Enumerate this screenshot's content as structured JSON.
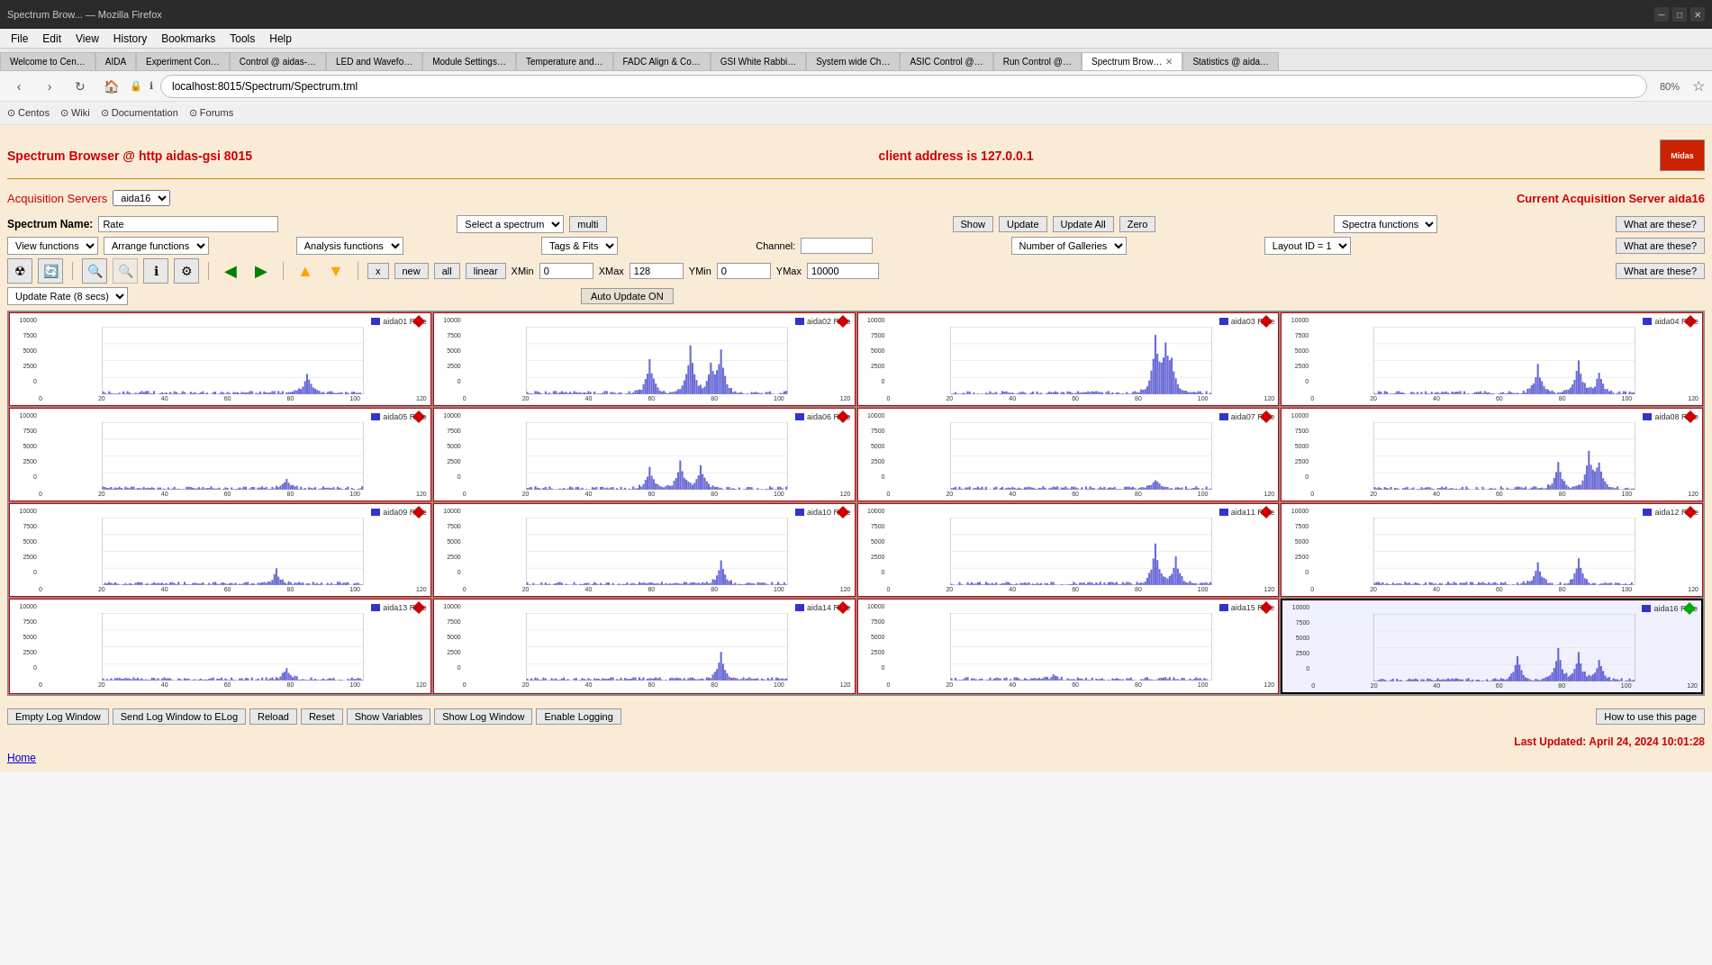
{
  "browser": {
    "title": "Spectrum Brow... — Mozilla Firefox",
    "url": "localhost:8015/Spectrum/Spectrum.tml",
    "zoom": "80%"
  },
  "menu": {
    "items": [
      "File",
      "Edit",
      "View",
      "History",
      "Bookmarks",
      "Tools",
      "Help"
    ]
  },
  "tabs": [
    {
      "label": "Welcome to Cen…",
      "active": false
    },
    {
      "label": "AIDA",
      "active": false
    },
    {
      "label": "Experiment Cont…",
      "active": false
    },
    {
      "label": "Control @ aidas-…",
      "active": false
    },
    {
      "label": "LED and Wavefo…",
      "active": false
    },
    {
      "label": "Module Settings…",
      "active": false
    },
    {
      "label": "Temperature and…",
      "active": false
    },
    {
      "label": "FADC Align & Co…",
      "active": false
    },
    {
      "label": "GSI White Rabbi…",
      "active": false
    },
    {
      "label": "System wide Ch…",
      "active": false
    },
    {
      "label": "ASIC Control @…",
      "active": false
    },
    {
      "label": "Run Control @…",
      "active": false
    },
    {
      "label": "Spectrum Brow…",
      "active": true,
      "closable": true
    },
    {
      "label": "Statistics @ aida…",
      "active": false
    }
  ],
  "bookmarks": [
    {
      "label": "Centos"
    },
    {
      "label": "Wiki"
    },
    {
      "label": "Documentation"
    },
    {
      "label": "Forums"
    }
  ],
  "page": {
    "title": "Spectrum Browser @ http aidas-gsi 8015",
    "client_address": "client address is 127.0.0.1",
    "acq_servers_label": "Acquisition Servers",
    "acq_server_value": "aida16",
    "current_server_label": "Current Acquisition Server aida16"
  },
  "controls": {
    "spectrum_name_label": "Spectrum Name:",
    "spectrum_name_value": "Rate",
    "select_spectrum": "Select a spectrum",
    "multi_btn": "multi",
    "show_btn": "Show",
    "update_btn": "Update",
    "update_all_btn": "Update All",
    "zero_btn": "Zero",
    "spectra_functions": "Spectra functions",
    "what_are_these_1": "What are these?",
    "view_functions": "View functions",
    "arrange_functions": "Arrange functions",
    "analysis_functions": "Analysis functions",
    "tags_fits": "Tags & Fits",
    "channel_label": "Channel:",
    "channel_value": "",
    "number_of_galleries": "Number of Galleries",
    "layout_id": "Layout ID = 1",
    "what_are_these_2": "What are these?",
    "x_btn": "x",
    "new_btn": "new",
    "all_btn": "all",
    "linear_btn": "linear",
    "xmin_label": "XMin",
    "xmin_value": "0",
    "xmax_label": "XMax",
    "xmax_value": "128",
    "ymin_label": "YMin",
    "ymin_value": "0",
    "ymax_label": "YMax",
    "ymax_value": "10000",
    "what_are_these_3": "What are these?",
    "update_rate": "Update Rate (8 secs)",
    "auto_update": "Auto Update ON"
  },
  "charts": [
    {
      "id": "aida01",
      "title": "aida01 Rate",
      "diamond": "red"
    },
    {
      "id": "aida02",
      "title": "aida02 Rate",
      "diamond": "red"
    },
    {
      "id": "aida03",
      "title": "aida03 Rate",
      "diamond": "red"
    },
    {
      "id": "aida04",
      "title": "aida04 Rate",
      "diamond": "red"
    },
    {
      "id": "aida05",
      "title": "aida05 Rate",
      "diamond": "red"
    },
    {
      "id": "aida06",
      "title": "aida06 Rate",
      "diamond": "red"
    },
    {
      "id": "aida07",
      "title": "aida07 Rate",
      "diamond": "red"
    },
    {
      "id": "aida08",
      "title": "aida08 Rate",
      "diamond": "red"
    },
    {
      "id": "aida09",
      "title": "aida09 Rate",
      "diamond": "red"
    },
    {
      "id": "aida10",
      "title": "aida10 Rate",
      "diamond": "red"
    },
    {
      "id": "aida11",
      "title": "aida11 Rate",
      "diamond": "red"
    },
    {
      "id": "aida12",
      "title": "aida12 Rate",
      "diamond": "red"
    },
    {
      "id": "aida13",
      "title": "aida13 Rate",
      "diamond": "red"
    },
    {
      "id": "aida14",
      "title": "aida14 Rate",
      "diamond": "red"
    },
    {
      "id": "aida15",
      "title": "aida15 Rate",
      "diamond": "red"
    },
    {
      "id": "aida16",
      "title": "aida16 Rate",
      "diamond": "green",
      "selected": true
    }
  ],
  "bottom_bar": {
    "empty_log": "Empty Log Window",
    "send_log": "Send Log Window to ELog",
    "reload": "Reload",
    "reset": "Reset",
    "show_variables": "Show Variables",
    "show_log": "Show Log Window",
    "enable_logging": "Enable Logging",
    "how_to_use": "How to use this page"
  },
  "footer": {
    "last_updated": "Last Updated: April 24, 2024 10:01:28",
    "home": "Home"
  }
}
